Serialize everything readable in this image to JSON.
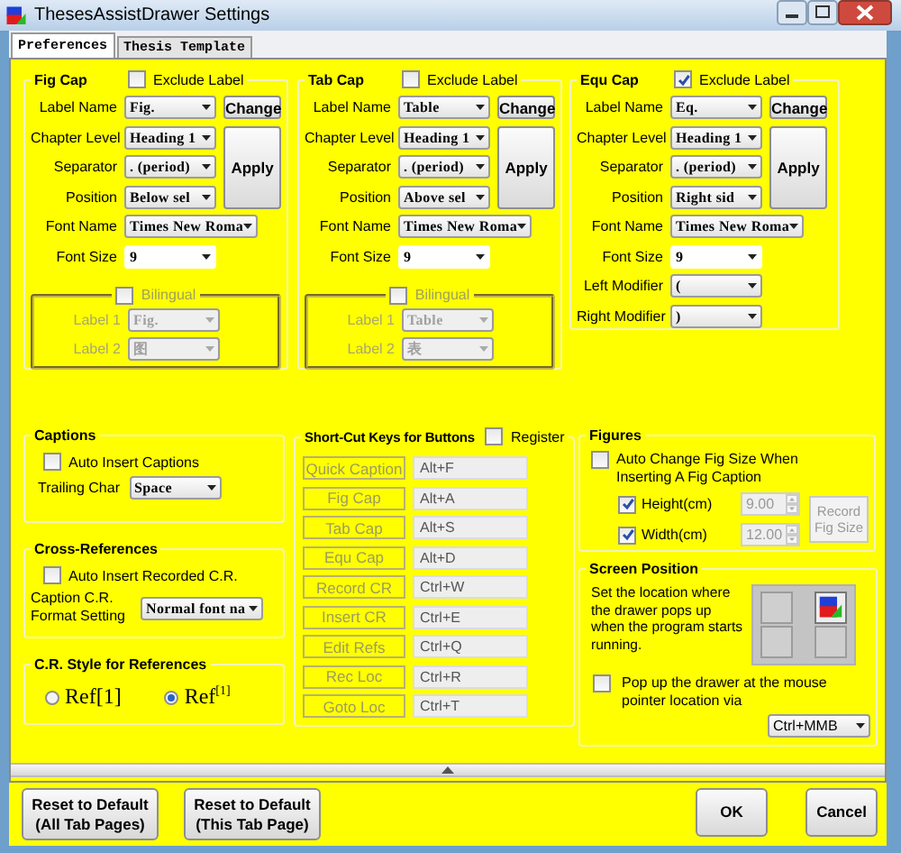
{
  "window": {
    "title": "ThesesAssistDrawer Settings"
  },
  "tabs": [
    {
      "label": "Preferences",
      "selected": true
    },
    {
      "label": "Thesis Template",
      "selected": false
    }
  ],
  "caption_groups": [
    {
      "title": "Fig Cap",
      "exclude_label": {
        "label": "Exclude Label",
        "checked": false
      },
      "change_button": "Change",
      "apply_button": "Apply",
      "fields": [
        {
          "label": "Label Name",
          "value": "Fig.",
          "kind": "dropdown"
        },
        {
          "label": "Chapter Level",
          "value": "Heading 1",
          "kind": "dropdown"
        },
        {
          "label": "Separator",
          "value": ". (period)",
          "kind": "dropdown"
        },
        {
          "label": "Position",
          "value": "Below sel",
          "kind": "dropdown"
        },
        {
          "label": "Font Name",
          "value": "Times New Roma",
          "kind": "wide"
        },
        {
          "label": "Font Size",
          "value": "9",
          "kind": "editable"
        }
      ],
      "bilingual": {
        "label": "Bilingual",
        "checked": false,
        "fields": [
          {
            "label": "Label 1",
            "value": "Fig."
          },
          {
            "label": "Label 2",
            "value": "图"
          }
        ]
      }
    },
    {
      "title": "Tab Cap",
      "exclude_label": {
        "label": "Exclude Label",
        "checked": false
      },
      "change_button": "Change",
      "apply_button": "Apply",
      "fields": [
        {
          "label": "Label Name",
          "value": "Table",
          "kind": "dropdown"
        },
        {
          "label": "Chapter Level",
          "value": "Heading 1",
          "kind": "dropdown"
        },
        {
          "label": "Separator",
          "value": ". (period)",
          "kind": "dropdown"
        },
        {
          "label": "Position",
          "value": "Above sel",
          "kind": "dropdown"
        },
        {
          "label": "Font Name",
          "value": "Times New Roma",
          "kind": "wide"
        },
        {
          "label": "Font Size",
          "value": "9",
          "kind": "editable"
        }
      ],
      "bilingual": {
        "label": "Bilingual",
        "checked": false,
        "fields": [
          {
            "label": "Label 1",
            "value": "Table"
          },
          {
            "label": "Label 2",
            "value": "表"
          }
        ]
      }
    },
    {
      "title": "Equ Cap",
      "exclude_label": {
        "label": "Exclude Label",
        "checked": true
      },
      "change_button": "Change",
      "apply_button": "Apply",
      "fields": [
        {
          "label": "Label Name",
          "value": "Eq.",
          "kind": "dropdown"
        },
        {
          "label": "Chapter Level",
          "value": "Heading 1",
          "kind": "dropdown"
        },
        {
          "label": "Separator",
          "value": ". (period)",
          "kind": "dropdown"
        },
        {
          "label": "Position",
          "value": "Right sid",
          "kind": "dropdown"
        },
        {
          "label": "Font Name",
          "value": "Times New Roma",
          "kind": "wide"
        },
        {
          "label": "Font Size",
          "value": "9",
          "kind": "editable"
        },
        {
          "label": "Left Modifier",
          "value": "(",
          "kind": "dropdown"
        },
        {
          "label": "Right Modifier",
          "value": ")",
          "kind": "dropdown"
        }
      ]
    }
  ],
  "captions": {
    "title": "Captions",
    "auto_insert": {
      "label": "Auto Insert Captions",
      "checked": false
    },
    "trailing_char": {
      "label": "Trailing Char",
      "value": "Space"
    }
  },
  "cross_references": {
    "title": "Cross-References",
    "auto_insert": {
      "label": "Auto Insert Recorded C.R.",
      "checked": false
    },
    "format": {
      "label": "Caption C.R. Format Setting",
      "value": "Normal font na"
    }
  },
  "cr_style": {
    "title": "C.R. Style for References",
    "options": [
      {
        "label": "Ref[1]",
        "selected": false
      },
      {
        "label": "Ref$^{[1]}$",
        "selected": true
      }
    ]
  },
  "shortcuts": {
    "title": "Short-Cut Keys for Buttons",
    "register": {
      "label": "Register",
      "checked": false
    },
    "rows": [
      {
        "button": "Quick Caption",
        "keys": "Alt+F"
      },
      {
        "button": "Fig Cap",
        "keys": "Alt+A"
      },
      {
        "button": "Tab Cap",
        "keys": "Alt+S"
      },
      {
        "button": "Equ Cap",
        "keys": "Alt+D"
      },
      {
        "button": "Record CR",
        "keys": "Ctrl+W"
      },
      {
        "button": "Insert CR",
        "keys": "Ctrl+E"
      },
      {
        "button": "Edit Refs",
        "keys": "Ctrl+Q"
      },
      {
        "button": "Rec Loc",
        "keys": "Ctrl+R"
      },
      {
        "button": "Goto Loc",
        "keys": "Ctrl+T"
      }
    ]
  },
  "figures": {
    "title": "Figures",
    "auto_change": {
      "label": "Auto Change Fig Size When Inserting A Fig Caption",
      "checked": false
    },
    "sizes": [
      {
        "label": "Height(cm)",
        "checked": true,
        "value": "9.00"
      },
      {
        "label": "Width(cm)",
        "checked": true,
        "value": "12.00"
      }
    ],
    "record_button": "Record Fig Size"
  },
  "screen_position": {
    "title": "Screen Position",
    "description": "Set the location where the drawer pops up when the program starts running.",
    "positions": [
      {
        "selected": false
      },
      {
        "selected": true
      },
      {
        "selected": false
      },
      {
        "selected": false
      }
    ],
    "popup": {
      "label": "Pop up the drawer at the mouse pointer location via",
      "checked": false,
      "key": "Ctrl+MMB"
    }
  },
  "footer_buttons": [
    {
      "label": "Reset to Default (All Tab Pages)",
      "kind": "wide"
    },
    {
      "label": "Reset to Default (This Tab Page)",
      "kind": "wide"
    },
    {
      "label": "OK",
      "kind": "small"
    },
    {
      "label": "Cancel",
      "kind": "small"
    }
  ]
}
